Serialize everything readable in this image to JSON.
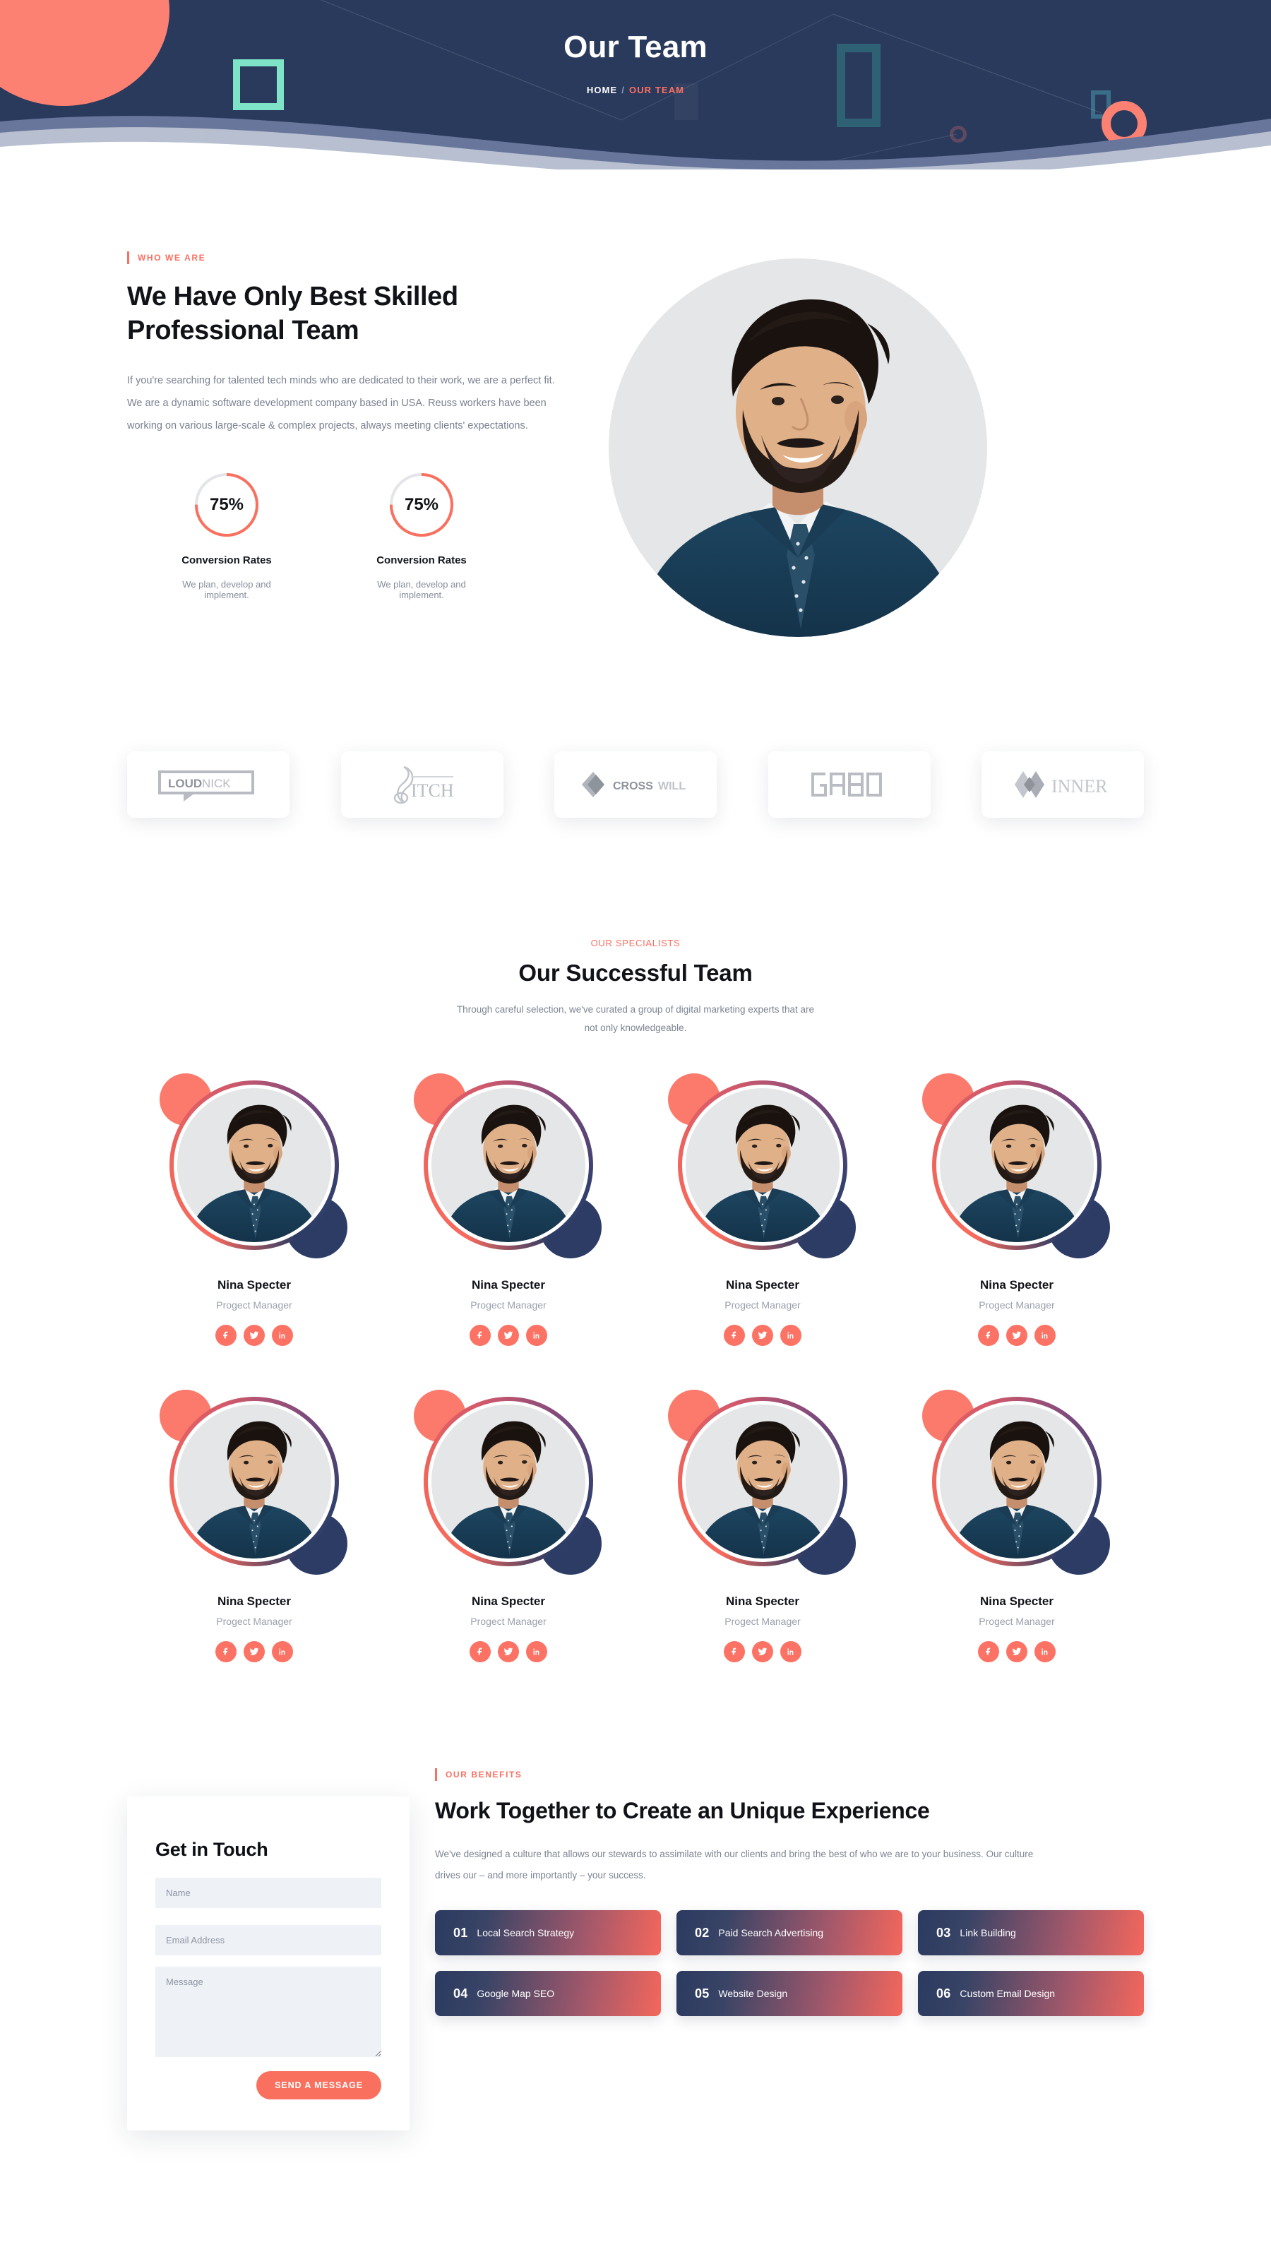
{
  "colors": {
    "navy": "#2a3a5c",
    "coral": "#fc6f60",
    "coral_soft": "#fc8173",
    "mint": "#7fe3c8",
    "teal": "#2f6175",
    "text_dark": "#111318",
    "text_muted": "#7a8191",
    "field_bg": "#eef1f6"
  },
  "banner": {
    "title": "Our Team",
    "breadcrumb": {
      "home": "HOME",
      "separator": "/",
      "current": "OUR TEAM"
    }
  },
  "who_we_are": {
    "eyebrow": "WHO WE ARE",
    "heading": "We Have Only Best Skilled Professional Team",
    "body": "If you're searching for talented tech minds who are dedicated to their work, we are a perfect fit. We are a dynamic software development company based in USA. Reuss workers have been working on various large-scale & complex projects, always meeting clients' expectations.",
    "stats": [
      {
        "percent": "75%",
        "value": 75,
        "title": "Conversion Rates",
        "description": "We plan, develop and implement."
      },
      {
        "percent": "75%",
        "value": 75,
        "title": "Conversion Rates",
        "description": "We plan, develop and implement."
      }
    ],
    "portrait_alt": "Smiling bearded man in a navy suit and polka-dot tie"
  },
  "brands": [
    {
      "name": "LOUDNICK",
      "icon": "loudnick-logo"
    },
    {
      "name": "ITCH",
      "icon": "itch-logo"
    },
    {
      "name": "CROSSWILL",
      "icon": "crosswill-logo"
    },
    {
      "name": "GABO",
      "icon": "gabo-logo"
    },
    {
      "name": "INNER",
      "icon": "inner-logo"
    }
  ],
  "team_section": {
    "kicker": "OUR SPECIALISTS",
    "title": "Our Successful Team",
    "subtitle": "Through careful selection, we've curated a group of digital marketing experts that are not only knowledgeable.",
    "members": [
      {
        "name": "Nina Specter",
        "role": "Progect Manager"
      },
      {
        "name": "Nina Specter",
        "role": "Progect Manager"
      },
      {
        "name": "Nina Specter",
        "role": "Progect Manager"
      },
      {
        "name": "Nina Specter",
        "role": "Progect Manager"
      },
      {
        "name": "Nina Specter",
        "role": "Progect Manager"
      },
      {
        "name": "Nina Specter",
        "role": "Progect Manager"
      },
      {
        "name": "Nina Specter",
        "role": "Progect Manager"
      },
      {
        "name": "Nina Specter",
        "role": "Progect Manager"
      }
    ],
    "social_icons": [
      "facebook-icon",
      "twitter-icon",
      "linkedin-icon"
    ]
  },
  "contact": {
    "title": "Get in Touch",
    "name_placeholder": "Name",
    "name_value": "",
    "email_placeholder": "Email Address",
    "email_value": "",
    "message_placeholder": "Message",
    "message_value": "",
    "submit_label": "SEND A MESSAGE"
  },
  "benefits": {
    "eyebrow": "OUR BENEFITS",
    "heading": "Work Together to Create an Unique Experience",
    "body": "We've designed a culture that allows our stewards to assimilate with our clients and bring the best of who we are to your business. Our culture drives our – and more importantly – your success.",
    "cards": [
      {
        "number": "01",
        "label": "Local Search Strategy"
      },
      {
        "number": "02",
        "label": "Paid Search Advertising"
      },
      {
        "number": "03",
        "label": "Link Building"
      },
      {
        "number": "04",
        "label": "Google Map SEO"
      },
      {
        "number": "05",
        "label": "Website Design"
      },
      {
        "number": "06",
        "label": "Custom Email Design"
      }
    ]
  }
}
